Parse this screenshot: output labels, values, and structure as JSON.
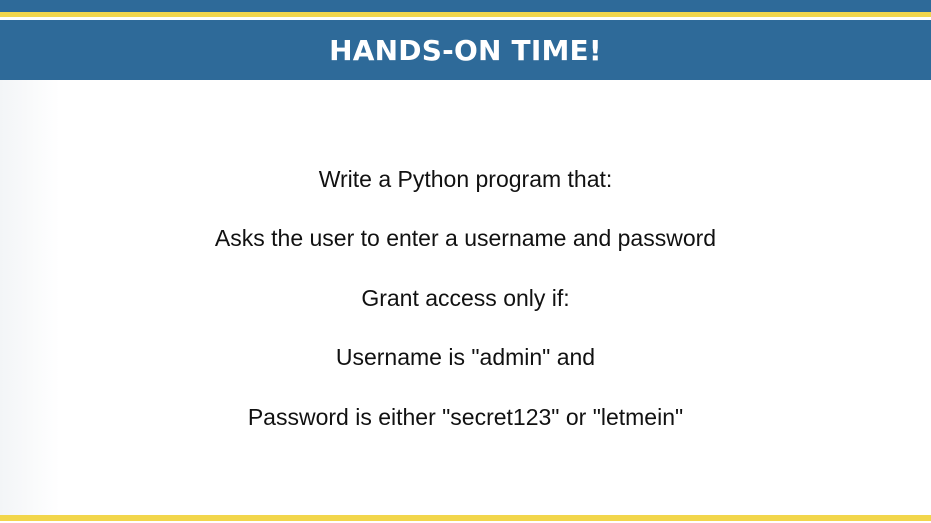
{
  "slide": {
    "title": "HANDS-ON TIME!",
    "lines": [
      "Write a Python program that:",
      "Asks the user to enter a username and password",
      "Grant access only if:",
      "Username is \"admin\" and",
      "Password is either \"secret123\" or \"letmein\""
    ],
    "colors": {
      "header_blue": "#2e6a99",
      "accent_gold": "#f2d64b",
      "text": "#111111"
    }
  }
}
